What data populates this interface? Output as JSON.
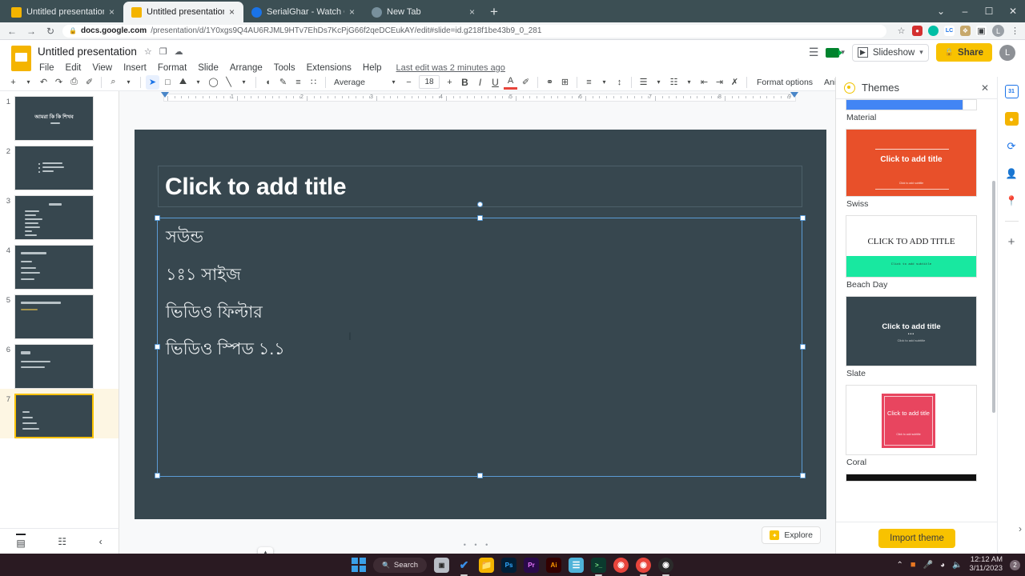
{
  "browser": {
    "tabs": [
      {
        "title": "Untitled presentation - Google S",
        "active": false,
        "favicon": "#f4b400"
      },
      {
        "title": "Untitled presentation - Google S",
        "active": true,
        "favicon": "#f4b400"
      },
      {
        "title": "SerialGhar - Watch Online Indian",
        "active": false,
        "favicon": "#1a73e8"
      },
      {
        "title": "New Tab",
        "active": false,
        "favicon": "#5f6368"
      }
    ],
    "new_tab_label": "+",
    "close_glyph": "×",
    "window_controls": {
      "minimize": "–",
      "maximize": "☐",
      "close": "✕",
      "chevron": "⌄"
    },
    "nav": {
      "back": "←",
      "forward": "→",
      "reload": "↻",
      "lock": "🔒"
    },
    "url_host": "docs.google.com",
    "url_path": "/presentation/d/1Y0xgs9Q4AU6RJML9HTv7EhDs7KcPjG66f2qeDCEukAY/edit#slide=id.g218f1be43b9_0_281",
    "extensions": [
      {
        "name": "bookmark-star-icon",
        "glyph": "☆",
        "color": "transparent"
      },
      {
        "name": "extension-red-icon",
        "glyph": "",
        "color": "#d32f2f"
      },
      {
        "name": "extension-teal-icon",
        "glyph": "",
        "color": "#00bfa5"
      },
      {
        "name": "lastpass-icon",
        "glyph": "LC",
        "color": "#1a73e8"
      },
      {
        "name": "puzzle-extensions-icon",
        "glyph": "❖",
        "color": "#c7a86b"
      },
      {
        "name": "sidepanel-icon",
        "glyph": "▣",
        "color": "#5f6368"
      }
    ],
    "profile_initial": "L",
    "menu_glyph": "⋮"
  },
  "app": {
    "logo_name": "google-slides-logo",
    "doc_title": "Untitled presentation",
    "title_actions": [
      {
        "name": "star-icon",
        "glyph": "☆"
      },
      {
        "name": "move-to-folder-icon",
        "glyph": "❐"
      },
      {
        "name": "cloud-saved-icon",
        "glyph": "☁"
      }
    ],
    "menus": [
      "File",
      "Edit",
      "View",
      "Insert",
      "Format",
      "Slide",
      "Arrange",
      "Tools",
      "Extensions",
      "Help"
    ],
    "last_edit": "Last edit was 2 minutes ago",
    "comment_history_icon": "☰",
    "meet_label": "▾",
    "slideshow_label": "Slideshow",
    "slideshow_caret": "▾",
    "share_label": "Share",
    "share_lock": "🔒",
    "account_initial": "L"
  },
  "toolbar": {
    "groups": [
      {
        "name": "new-slide-button",
        "glyph": "+"
      },
      {
        "name": "new-slide-dropdown",
        "glyph": "▾"
      },
      {
        "name": "undo-button",
        "glyph": "↶"
      },
      {
        "name": "redo-button",
        "glyph": "↷"
      },
      {
        "name": "print-button",
        "glyph": "⎙"
      },
      {
        "name": "paint-format-button",
        "glyph": "✐"
      },
      {
        "name": "zoom-button",
        "glyph": "⌕"
      },
      {
        "name": "zoom-dropdown",
        "glyph": "▾"
      },
      {
        "name": "select-tool-button",
        "glyph": "➤",
        "selected": true
      },
      {
        "name": "text-box-button",
        "glyph": "□"
      },
      {
        "name": "insert-image-button",
        "glyph": "⛰"
      },
      {
        "name": "insert-image-dropdown",
        "glyph": "▾"
      },
      {
        "name": "shape-button",
        "glyph": "◯"
      },
      {
        "name": "line-button",
        "glyph": "╲"
      },
      {
        "name": "line-dropdown",
        "glyph": "▾"
      },
      {
        "name": "fill-color-button",
        "glyph": "◖"
      },
      {
        "name": "border-color-button",
        "glyph": "✎"
      },
      {
        "name": "border-weight-button",
        "glyph": "≡"
      },
      {
        "name": "border-dash-button",
        "glyph": "∷"
      }
    ],
    "font_family": "Average",
    "font_family_caret": "▾",
    "font_decrease": "−",
    "font_size": "18",
    "font_increase": "+",
    "text_tools": [
      {
        "name": "bold-button",
        "glyph": "B"
      },
      {
        "name": "italic-button",
        "glyph": "I"
      },
      {
        "name": "underline-button",
        "glyph": "U"
      },
      {
        "name": "text-color-button",
        "glyph": "A"
      },
      {
        "name": "highlight-color-button",
        "glyph": "✐"
      },
      {
        "name": "insert-link-button",
        "glyph": "⚭"
      },
      {
        "name": "insert-comment-button",
        "glyph": "⊞"
      },
      {
        "name": "align-button",
        "glyph": "≡"
      },
      {
        "name": "align-dropdown",
        "glyph": "▾"
      },
      {
        "name": "line-spacing-button",
        "glyph": "↕"
      },
      {
        "name": "bulleted-list-button",
        "glyph": "☰"
      },
      {
        "name": "bulleted-list-dropdown",
        "glyph": "▾"
      },
      {
        "name": "numbered-list-button",
        "glyph": "☷"
      },
      {
        "name": "numbered-list-dropdown",
        "glyph": "▾"
      },
      {
        "name": "decrease-indent-button",
        "glyph": "⇤"
      },
      {
        "name": "increase-indent-button",
        "glyph": "⇥"
      },
      {
        "name": "clear-formatting-button",
        "glyph": "✗"
      }
    ],
    "format_options_label": "Format options",
    "animate_label": "Animate",
    "collapse_glyph": "⌃"
  },
  "filmstrip": {
    "slides": [
      {
        "num": "1",
        "type": "title",
        "title": "আমরা কি কি শিখব",
        "selected": false
      },
      {
        "num": "2",
        "type": "bullets",
        "lines": 3,
        "selected": false
      },
      {
        "num": "3",
        "type": "centered-list",
        "lines": 7,
        "selected": false
      },
      {
        "num": "4",
        "type": "left-title",
        "lines": 4,
        "selected": false
      },
      {
        "num": "5",
        "type": "left-title",
        "lines": 1,
        "selected": false
      },
      {
        "num": "6",
        "type": "left-title",
        "lines": 2,
        "selected": false
      },
      {
        "num": "7",
        "type": "left-body",
        "lines": 4,
        "selected": true
      }
    ],
    "bottom_buttons": [
      {
        "name": "filmstrip-view-button",
        "glyph": "▤"
      },
      {
        "name": "grid-view-button",
        "glyph": "☷"
      },
      {
        "name": "collapse-filmstrip-button",
        "glyph": "‹"
      }
    ]
  },
  "canvas": {
    "ruler_numbers": [
      "1",
      "2",
      "3",
      "4",
      "5",
      "6",
      "7",
      "8",
      "9"
    ],
    "slide_bg": "#37474f",
    "title_placeholder": "Click to add title",
    "body_lines": [
      "সউন্ড",
      "১ঃ১ সাইজ",
      "ভিডিও  ফিল্টার",
      "ভিডিও স্পিড ১.১"
    ],
    "valign_icon": "vertical-align-icon",
    "explore_label": "Explore",
    "notes_dots": "• • •"
  },
  "themes": {
    "panel_title": "Themes",
    "close_glyph": "✕",
    "items": [
      {
        "label": "Material",
        "bg": "#ffffff",
        "accent": "#4285f4",
        "title": "",
        "partial": true
      },
      {
        "label": "Swiss",
        "bg": "#e8502a",
        "accent": "#e8502a",
        "title": "Click to add title",
        "subtitle": "Click to add subtitle",
        "title_color": "#ffffff"
      },
      {
        "label": "Beach Day",
        "bg": "#ffffff",
        "accent": "#18e8a0",
        "title": "CLICK TO ADD TITLE",
        "subtitle": "Click to add subtitle",
        "title_color": "#202124"
      },
      {
        "label": "Slate",
        "bg": "#37474f",
        "accent": "#37474f",
        "title": "Click to add title",
        "subtitle": "Click to add subtitle",
        "title_color": "#ffffff"
      },
      {
        "label": "Coral",
        "bg": "#ffffff",
        "accent": "#e8455f",
        "title": "Click to add title",
        "subtitle": "Click to add subtitle",
        "title_color": "#ffffff"
      },
      {
        "label": "",
        "bg": "#111111",
        "accent": "#111111",
        "title": "",
        "partial": true
      }
    ],
    "import_label": "Import theme"
  },
  "rail": {
    "icons": [
      {
        "name": "google-calendar-icon",
        "glyph": "31",
        "color": "#1a73e8"
      },
      {
        "name": "google-keep-icon",
        "glyph": "◉",
        "color": "#f4b400"
      },
      {
        "name": "google-tasks-icon",
        "glyph": "✓",
        "color": "#1a73e8"
      },
      {
        "name": "google-contacts-icon",
        "glyph": "●",
        "color": "#1a73e8"
      },
      {
        "name": "google-maps-icon",
        "glyph": "◉",
        "color": "#34a853"
      },
      {
        "name": "add-on-button",
        "glyph": "+",
        "color": "#5f6368"
      }
    ],
    "collapse_glyph": "›"
  },
  "taskbar": {
    "start_name": "windows-start-button",
    "search_label": "Search",
    "search_icon": "🔍",
    "apps": [
      {
        "name": "task-view-button",
        "glyph": "❐",
        "color": "#b9bec6",
        "running": false
      },
      {
        "name": "todoist-icon",
        "glyph": "✔",
        "color": "#2f7fe0",
        "running": true
      },
      {
        "name": "file-explorer-icon",
        "glyph": "📁",
        "color": "#f4b400",
        "running": false
      },
      {
        "name": "photoshop-icon",
        "glyph": "Ps",
        "color": "#001e36",
        "running": false
      },
      {
        "name": "premiere-pro-icon",
        "glyph": "Pr",
        "color": "#2a0a4a",
        "running": false
      },
      {
        "name": "illustrator-icon",
        "glyph": "Ai",
        "color": "#330000",
        "running": false
      },
      {
        "name": "notepad-icon",
        "glyph": "≡",
        "color": "#4fb3d9",
        "running": false
      },
      {
        "name": "terminal-icon",
        "glyph": ">_",
        "color": "#0b3a2e",
        "running": true
      },
      {
        "name": "chrome-icon",
        "glyph": "◉",
        "color": "#e8453c",
        "running": false
      },
      {
        "name": "chrome-active-icon",
        "glyph": "◉",
        "color": "#e8453c",
        "running": true
      },
      {
        "name": "obs-studio-icon",
        "glyph": "●",
        "color": "#2b2b2b",
        "running": true
      }
    ],
    "tray": {
      "chevron": "⌃",
      "icons": [
        {
          "name": "tray-app-icon",
          "glyph": "■",
          "color": "#e87722"
        },
        {
          "name": "microphone-icon",
          "glyph": "🎤",
          "color": "transparent"
        },
        {
          "name": "wifi-icon",
          "glyph": "◠",
          "color": "transparent"
        },
        {
          "name": "volume-icon",
          "glyph": "🔊",
          "color": "transparent"
        }
      ],
      "time": "12:12 AM",
      "date": "3/11/2023",
      "notification_count": "2"
    }
  }
}
